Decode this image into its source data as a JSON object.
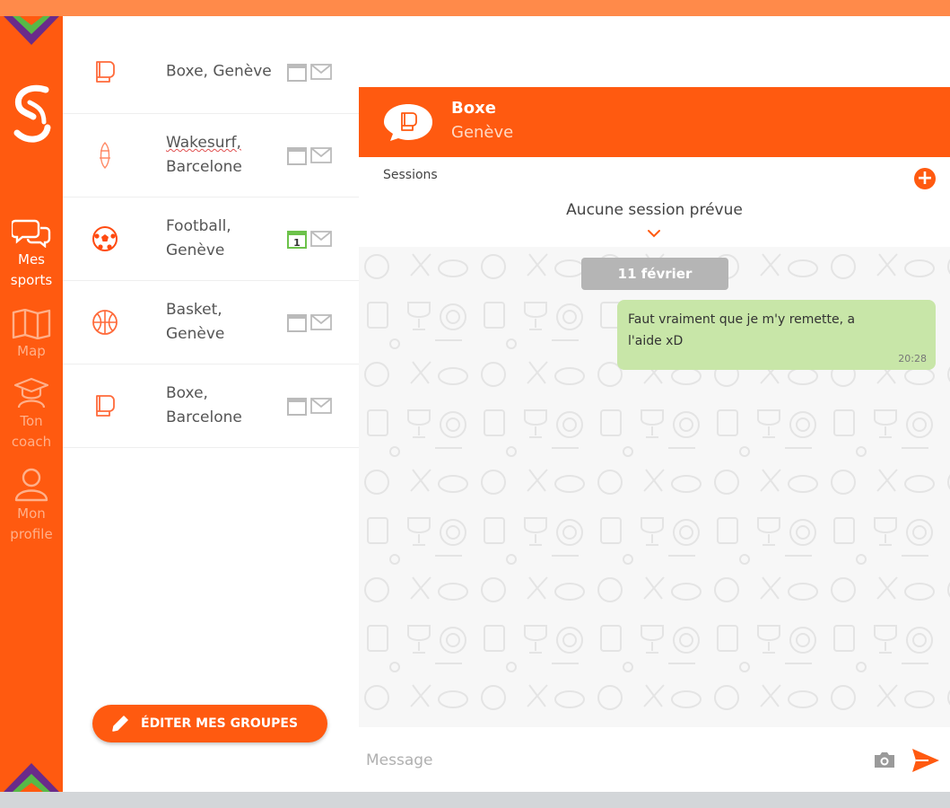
{
  "colors": {
    "accent": "#ff5a10",
    "nav_inactive": "#ffb08a",
    "bubble": "#c8e6a8",
    "date_chip": "#b5b5b5",
    "calendar_active": "#6cc24a"
  },
  "nav": {
    "items": [
      {
        "label_lines": [
          "Mes",
          "sports"
        ],
        "icon": "chat-bubbles-icon",
        "active": true
      },
      {
        "label_lines": [
          "Map"
        ],
        "icon": "map-icon",
        "active": false
      },
      {
        "label_lines": [
          "Ton",
          "coach"
        ],
        "icon": "coach-icon",
        "active": false
      },
      {
        "label_lines": [
          "Mon",
          "profile"
        ],
        "icon": "user-icon",
        "active": false
      }
    ]
  },
  "groups": [
    {
      "lines": [
        "Boxe, Genève"
      ],
      "icon": "boxing-glove-icon",
      "calendar_badge": ""
    },
    {
      "lines": [
        "Wakesurf,",
        "Barcelone"
      ],
      "icon": "surfboard-icon",
      "calendar_badge": "",
      "misspelled": true
    },
    {
      "lines": [
        "Football,",
        "Genève"
      ],
      "icon": "soccer-ball-icon",
      "calendar_badge": "1"
    },
    {
      "lines": [
        "Basket,",
        "Genève"
      ],
      "icon": "basketball-icon",
      "calendar_badge": ""
    },
    {
      "lines": [
        "Boxe,",
        "Barcelone"
      ],
      "icon": "boxing-glove-icon",
      "calendar_badge": ""
    }
  ],
  "edit_button": {
    "label": "ÉDITER MES GROUPES"
  },
  "chat": {
    "title": "Boxe",
    "subtitle": "Genève",
    "sessions_label": "Sessions",
    "add_label": "+",
    "no_session": "Aucune session prévue",
    "date_chip": "11 février",
    "messages": [
      {
        "lines": [
          "Faut vraiment que je m'y remette, a",
          "l'aide xD"
        ],
        "time": "20:28",
        "outgoing": true
      }
    ],
    "composer": {
      "placeholder": "Message",
      "value": ""
    }
  }
}
